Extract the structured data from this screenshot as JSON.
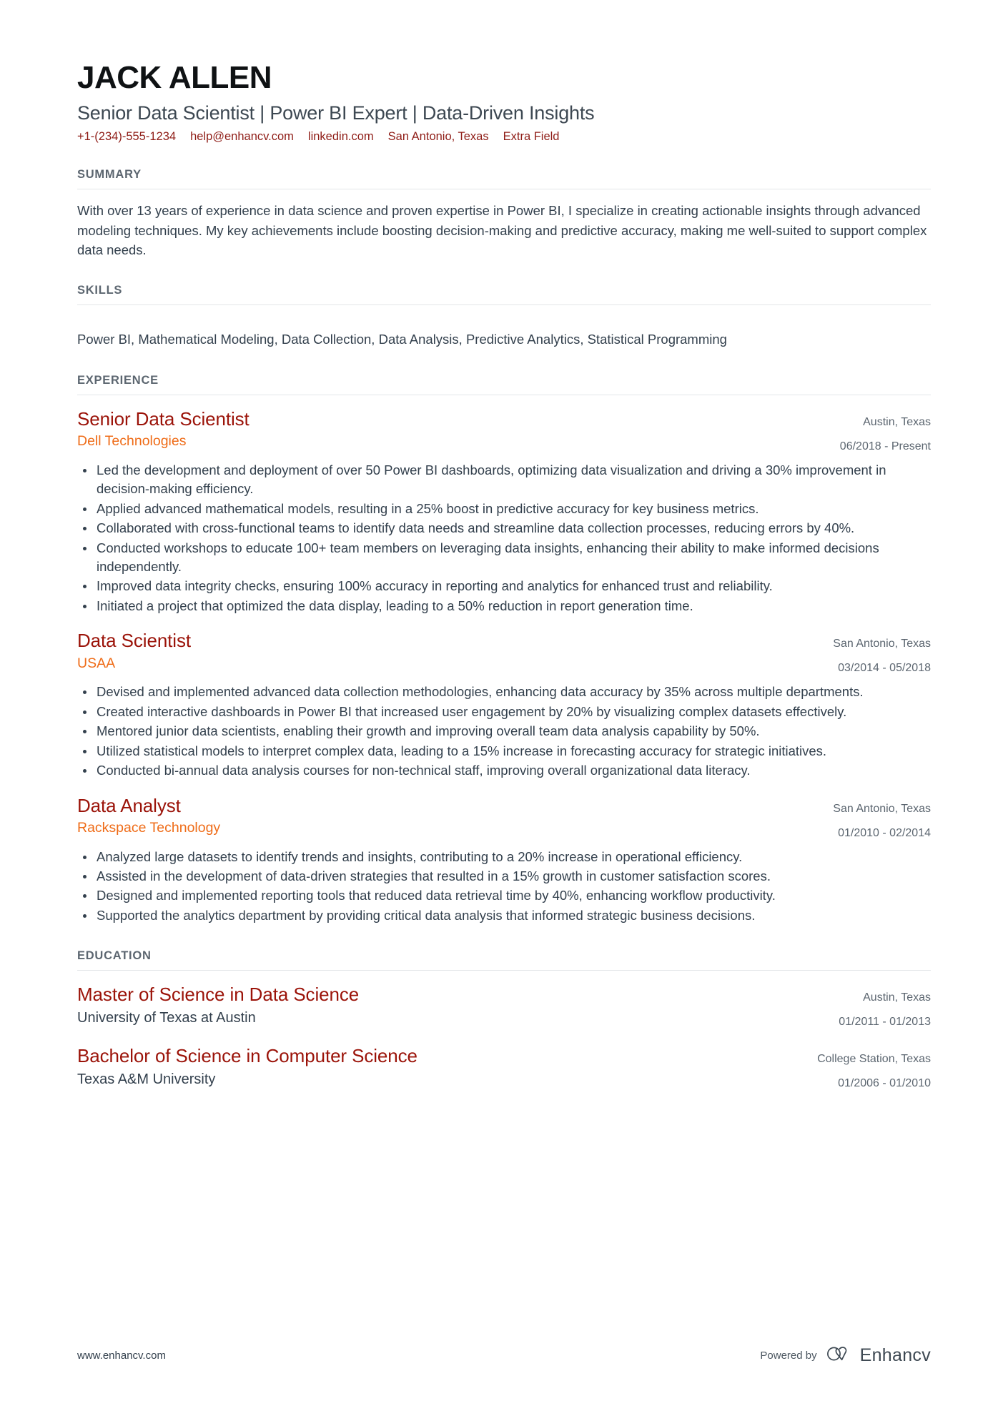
{
  "theme": {
    "accent_title": "#9b1309",
    "accent_company": "#ef6c18",
    "accent_contact": "#8f1d17",
    "text": "#33404d",
    "muted": "#5c6670",
    "rule": "#e3e6e8",
    "background": "#ffffff"
  },
  "header": {
    "name": "JACK ALLEN",
    "headline": "Senior Data Scientist | Power BI Expert | Data-Driven Insights",
    "contacts": [
      {
        "name": "phone",
        "label": "+1-(234)-555-1234"
      },
      {
        "name": "email",
        "label": "help@enhancv.com"
      },
      {
        "name": "linkedin",
        "label": "linkedin.com"
      },
      {
        "name": "location",
        "label": "San Antonio, Texas"
      },
      {
        "name": "extra-field",
        "label": "Extra Field"
      }
    ]
  },
  "sections": {
    "summary": {
      "title": "SUMMARY",
      "text": "With over 13 years of experience in data science and proven expertise in Power BI, I specialize in creating actionable insights through advanced modeling techniques. My key achievements include boosting decision-making and predictive accuracy, making me well-suited to support complex data needs."
    },
    "skills": {
      "title": "SKILLS",
      "list": "Power BI, Mathematical Modeling, Data Collection, Data Analysis, Predictive Analytics, Statistical Programming"
    },
    "experience": {
      "title": "EXPERIENCE",
      "entries": [
        {
          "title": "Senior Data Scientist",
          "company": "Dell Technologies",
          "location": "Austin, Texas",
          "dates": "06/2018 - Present",
          "bullets": [
            "Led the development and deployment of over 50 Power BI dashboards, optimizing data visualization and driving a 30% improvement in decision-making efficiency.",
            "Applied advanced mathematical models, resulting in a 25% boost in predictive accuracy for key business metrics.",
            "Collaborated with cross-functional teams to identify data needs and streamline data collection processes, reducing errors by 40%.",
            "Conducted workshops to educate 100+ team members on leveraging data insights, enhancing their ability to make informed decisions independently.",
            "Improved data integrity checks, ensuring 100% accuracy in reporting and analytics for enhanced trust and reliability.",
            "Initiated a project that optimized the data display, leading to a 50% reduction in report generation time."
          ]
        },
        {
          "title": "Data Scientist",
          "company": "USAA",
          "location": "San Antonio, Texas",
          "dates": "03/2014 - 05/2018",
          "bullets": [
            "Devised and implemented advanced data collection methodologies, enhancing data accuracy by 35% across multiple departments.",
            "Created interactive dashboards in Power BI that increased user engagement by 20% by visualizing complex datasets effectively.",
            "Mentored junior data scientists, enabling their growth and improving overall team data analysis capability by 50%.",
            "Utilized statistical models to interpret complex data, leading to a 15% increase in forecasting accuracy for strategic initiatives.",
            "Conducted bi-annual data analysis courses for non-technical staff, improving overall organizational data literacy."
          ]
        },
        {
          "title": "Data Analyst",
          "company": "Rackspace Technology",
          "location": "San Antonio, Texas",
          "dates": "01/2010 - 02/2014",
          "bullets": [
            "Analyzed large datasets to identify trends and insights, contributing to a 20% increase in operational efficiency.",
            "Assisted in the development of data-driven strategies that resulted in a 15% growth in customer satisfaction scores.",
            "Designed and implemented reporting tools that reduced data retrieval time by 40%, enhancing workflow productivity.",
            "Supported the analytics department by providing critical data analysis that informed strategic business decisions."
          ]
        }
      ]
    },
    "education": {
      "title": "EDUCATION",
      "entries": [
        {
          "title": "Master of Science in Data Science",
          "institution": "University of Texas at Austin",
          "location": "Austin, Texas",
          "dates": "01/2011 - 01/2013"
        },
        {
          "title": "Bachelor of Science in Computer Science",
          "institution": "Texas A&M University",
          "location": "College Station, Texas",
          "dates": "01/2006 - 01/2010"
        }
      ]
    }
  },
  "footer": {
    "url": "www.enhancv.com",
    "powered_by": "Powered by",
    "brand": "Enhancv",
    "brand_logo_icon": "enhancv-infinity-logo-icon"
  }
}
